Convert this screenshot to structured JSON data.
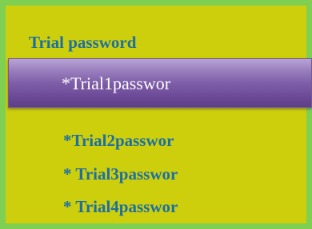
{
  "panel": {
    "title": "Trial password",
    "items": [
      "*Trial1passwor",
      "*Trial2passwor",
      "* Trial3passwor",
      "* Trial4passwor"
    ],
    "selected_index": 0
  },
  "colors": {
    "panel_background": "#cdcf0c",
    "panel_border": "#7fcf52",
    "text": "#1c6fa3",
    "selected_background": "#7e5ea8",
    "selected_text": "#ffffff"
  }
}
